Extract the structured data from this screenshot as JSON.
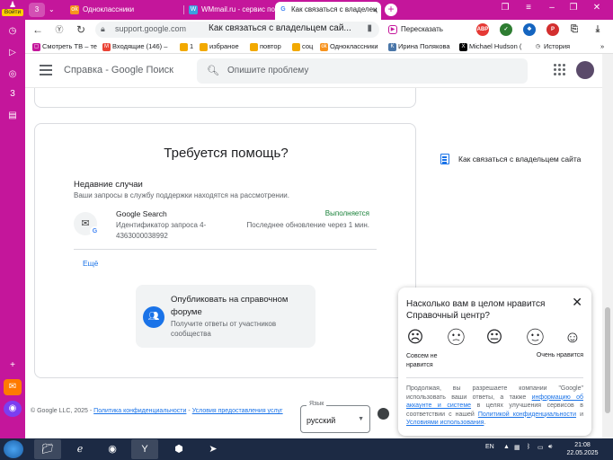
{
  "sidebar": {
    "login_label": "Войти",
    "badge": "3"
  },
  "tabs": [
    {
      "label": "Одноклассники",
      "icon": "odnoklassniki-icon",
      "color": "#f7931e"
    },
    {
      "label": "WMmail.ru - сервис почто",
      "icon": "wmmail-icon",
      "color": "#3aa0e0"
    },
    {
      "label": "Как связаться с владелец",
      "icon": "google-icon",
      "color": "#4285f4"
    }
  ],
  "tab_badge": "3",
  "address": {
    "url": "support.google.com",
    "title": "Как связаться с владельцем сай...",
    "retell": "Пересказать"
  },
  "bookmarks": [
    {
      "label": "Смотреть ТВ – те",
      "color": "#c4169b"
    },
    {
      "label": "Входящие (146) –",
      "color": "#ea4335"
    },
    {
      "label": "1",
      "color": "#f2a900"
    },
    {
      "label": "избраное",
      "color": "#f2a900"
    },
    {
      "label": "повтор",
      "color": "#f2a900"
    },
    {
      "label": "соц",
      "color": "#f2a900"
    },
    {
      "label": "Одноклассники",
      "color": "#f7931e"
    },
    {
      "label": "Ирина Полякова",
      "color": "#4a76a8"
    },
    {
      "label": "Michael Hudson (",
      "color": "#000000"
    },
    {
      "label": "История",
      "color": "#202124"
    }
  ],
  "header": {
    "title": "Справка - Google Поиск",
    "search_placeholder": "Опишите проблему"
  },
  "help": {
    "title": "Требуется помощь?",
    "recent_title": "Недавние случаи",
    "recent_sub": "Ваши запросы в службу поддержки находятся на рассмотрении.",
    "case": {
      "product": "Google Search",
      "id_text": "Идентификатор запроса 4-4363000038992",
      "status": "Выполняется",
      "updated": "Последнее обновление через 1 мин."
    },
    "more": "Ещё",
    "forum_title": "Опубликовать на справочном форуме",
    "forum_sub": "Получите ответы от участников сообщества"
  },
  "side_link": "Как связаться с владельцем сайта",
  "footer": {
    "copyright": "© Google LLC, 2025 -",
    "privacy": "Политика конфиденциальности",
    "sep": "-",
    "terms": "Условия предоставления услуг",
    "lang_label": "Язык",
    "lang_value": "русский"
  },
  "survey": {
    "question": "Насколько вам в целом нравится Справочный центр?",
    "low_label": "Совсем не нравится",
    "high_label": "Очень нравится",
    "legal_1": "Продолжая, вы разрешаете компании \"Google\" использовать ваши ответы, а также",
    "legal_link1": "информацию об аккаунте и системе",
    "legal_2": "в целях улучшения сервисов в соответствии с нашей",
    "legal_link2": "Политикой конфиденциальности",
    "legal_3": "и",
    "legal_link3": "Условиями использования",
    "legal_4": "."
  },
  "taskbar": {
    "lang": "EN",
    "time": "21:08",
    "date": "22.05.2025"
  }
}
